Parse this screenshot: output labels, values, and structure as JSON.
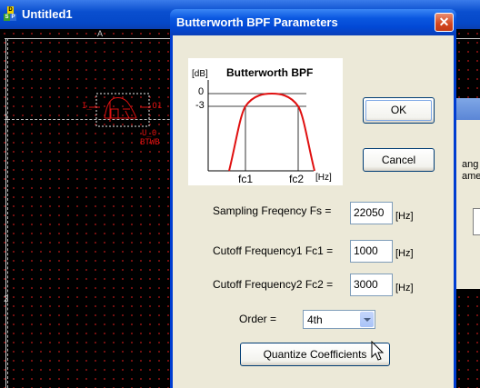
{
  "main_window": {
    "title": "Untitled1",
    "icon_letters": [
      "D",
      "S",
      "P"
    ],
    "ruler": {
      "column_label": "A",
      "row_labels": [
        "1",
        "2"
      ]
    },
    "component": {
      "pin_left": "I_",
      "pin_right": "_O1",
      "ref": "U_0",
      "name": "BTWB"
    }
  },
  "background_dialog": {
    "text_lines": [
      "ang",
      "amet"
    ]
  },
  "dialog": {
    "title": "Butterworth BPF Parameters",
    "close_label": "✕",
    "graph": {
      "title": "Butterworth BPF",
      "y_unit": "[dB]",
      "y_tick_0": "0",
      "y_tick_3": "-3",
      "x_label_fc1": "fc1",
      "x_label_fc2": "fc2",
      "x_unit": "[Hz]"
    },
    "ok_label": "OK",
    "cancel_label": "Cancel",
    "fields": [
      {
        "label": "Sampling Freqency Fs =",
        "value": "22050",
        "unit": "[Hz]"
      },
      {
        "label": "Cutoff Frequency1 Fc1 =",
        "value": "1000",
        "unit": "[Hz]"
      },
      {
        "label": "Cutoff Frequency2 Fc2 =",
        "value": "3000",
        "unit": "[Hz]"
      }
    ],
    "order": {
      "label": "Order =",
      "value": "4th"
    },
    "quantize_label": "Quantize Coefficients"
  },
  "colors": {
    "titlebar": "#0548c8",
    "dialog_body": "#ece9d8",
    "component": "#e01010",
    "grid_dot": "#7a1010"
  }
}
